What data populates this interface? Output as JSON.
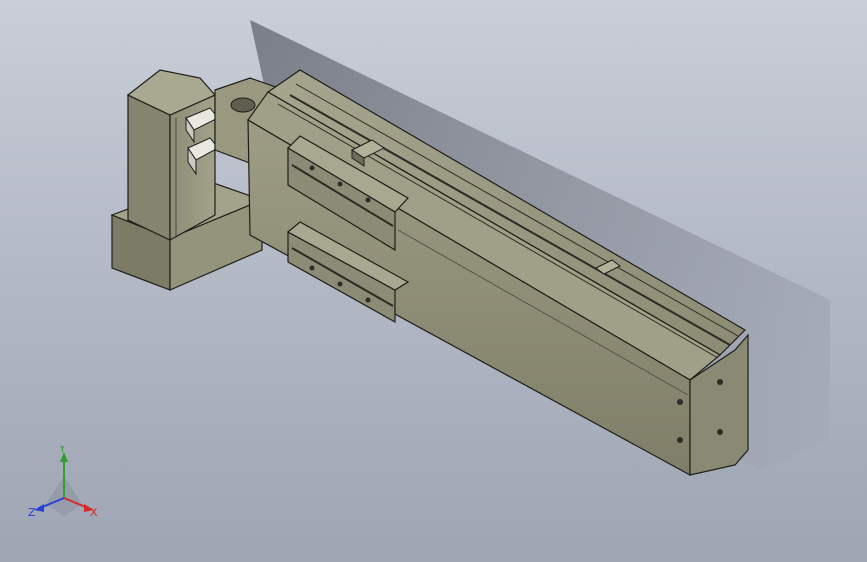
{
  "viewport": {
    "background_top": "#c9ced8",
    "background_bottom": "#9ea5b3",
    "model_color": "#8f8e77"
  },
  "triad": {
    "x_label": "X",
    "y_label": "Y",
    "z_label": "Z",
    "x_color": "#d62a2a",
    "y_color": "#2ea02e",
    "z_color": "#2a3fd6"
  }
}
